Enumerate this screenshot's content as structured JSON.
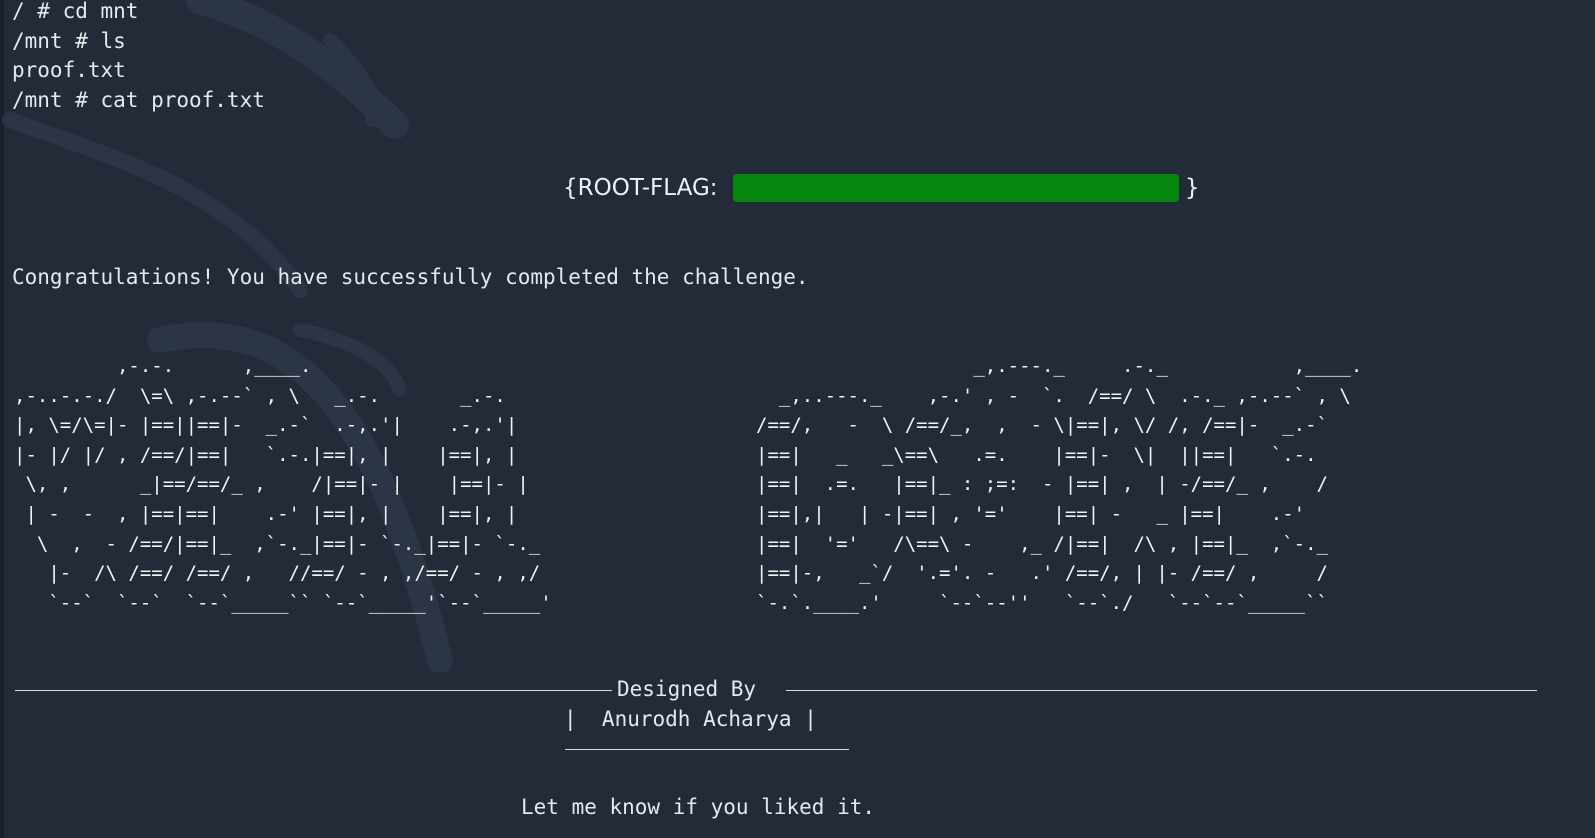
{
  "terminal": {
    "lines": [
      "/ # cd mnt",
      "/mnt # ls",
      "proof.txt",
      "/mnt # cat proof.txt"
    ],
    "flag_open": "{ROOT-FLAG: ",
    "flag_close": "}",
    "flag_redact_color": "#05860c",
    "congrats": "Congratulations! You have successfully completed the challenge.",
    "ascii_left": "         ,-.-.      ,____.\n,-..-.-./  \\=\\ ,-.--` , \\   _.-.       _.-.\n|, \\=/\\=|- |==||==|-  _.-`  .-,.'|    .-,.'|\n|- |/ |/ , /==/|==|   `.-.|==|, |    |==|, |\n \\, ,      _|==/==/_ ,    /|==|- |    |==|- |\n | -  -  , |==|==|    .-' |==|, |    |==|, |\n  \\  ,  - /==/|==|_  ,`-._|==|- `-._|==|- `-._\n   |-  /\\ /==/ /==/ ,   //==/ - , ,/==/ - , ,/\n   `--`  `--`  `--`_____`` `--`_____'`--`_____'",
    "ascii_right": "                   _,.---._     .-._           ,____.\n  _,..---._    ,-.' , -  `.  /==/ \\  .-._ ,-.--` , \\\n/==/,   -  \\ /==/_,  ,  - \\|==|, \\/ /, /==|-  _.-`\n|==|   _   _\\==\\   .=.    |==|-  \\|  ||==|   `.-.\n|==|  .=.   |==|_ : ;=:  - |==| ,  | -/==/_ ,    /\n|==|,|   | -|==| , '='    |==| -   _ |==|    .-'\n|==|  '='   /\\==\\ -    ,_ /|==|  /\\ , |==|_  ,`-._\n|==|-,   _`/  '.='. -   .' /==/, | |- /==/ ,     /\n`-.`.____.'     `--`--''   `--`./   `--`--`_____``",
    "designed_by": "Designed By",
    "author_line": "|  Anurodh Acharya |",
    "footer": "Let me know if you liked it."
  }
}
